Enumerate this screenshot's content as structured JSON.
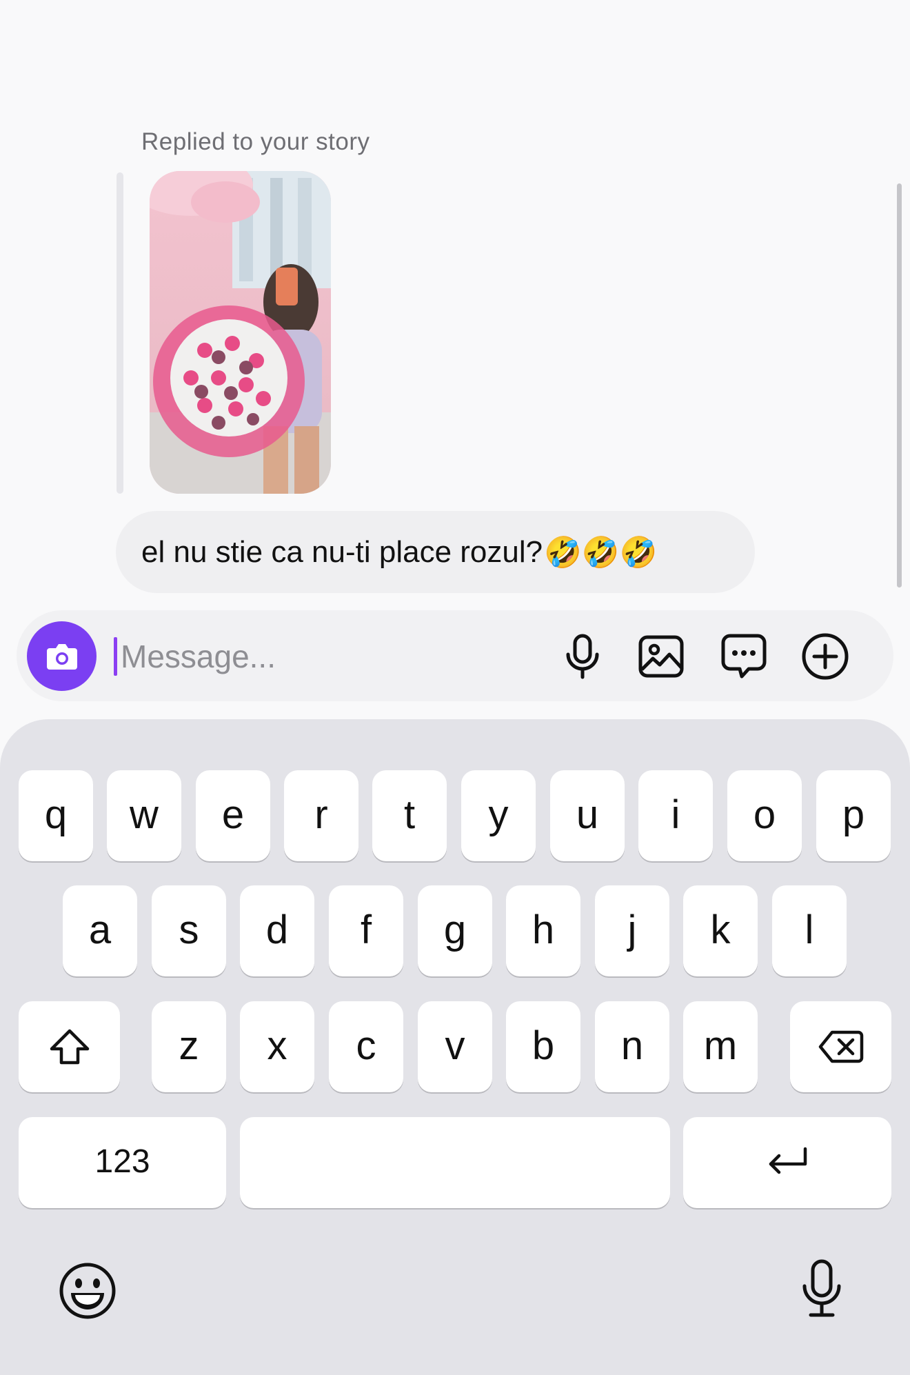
{
  "conversation": {
    "replied_label": "Replied to your story",
    "message_text": "el nu stie ca nu-ti place rozul?",
    "message_emojis": "🤣🤣🤣"
  },
  "composer": {
    "placeholder": "Message...",
    "icons": [
      "camera-icon",
      "microphone-icon",
      "gallery-icon",
      "sticker-chat-icon",
      "plus-circle-icon"
    ]
  },
  "keyboard": {
    "row1": [
      "q",
      "w",
      "e",
      "r",
      "t",
      "y",
      "u",
      "i",
      "o",
      "p"
    ],
    "row2": [
      "a",
      "s",
      "d",
      "f",
      "g",
      "h",
      "j",
      "k",
      "l"
    ],
    "row3": [
      "z",
      "x",
      "c",
      "v",
      "b",
      "n",
      "m"
    ],
    "numbers_label": "123",
    "icons": [
      "shift-icon",
      "backspace-icon",
      "return-icon",
      "emoji-icon",
      "dictation-icon"
    ]
  },
  "colors": {
    "accent": "#7b3ff2",
    "bubble": "#efeff1",
    "keyboard_bg": "#e3e3e8"
  }
}
